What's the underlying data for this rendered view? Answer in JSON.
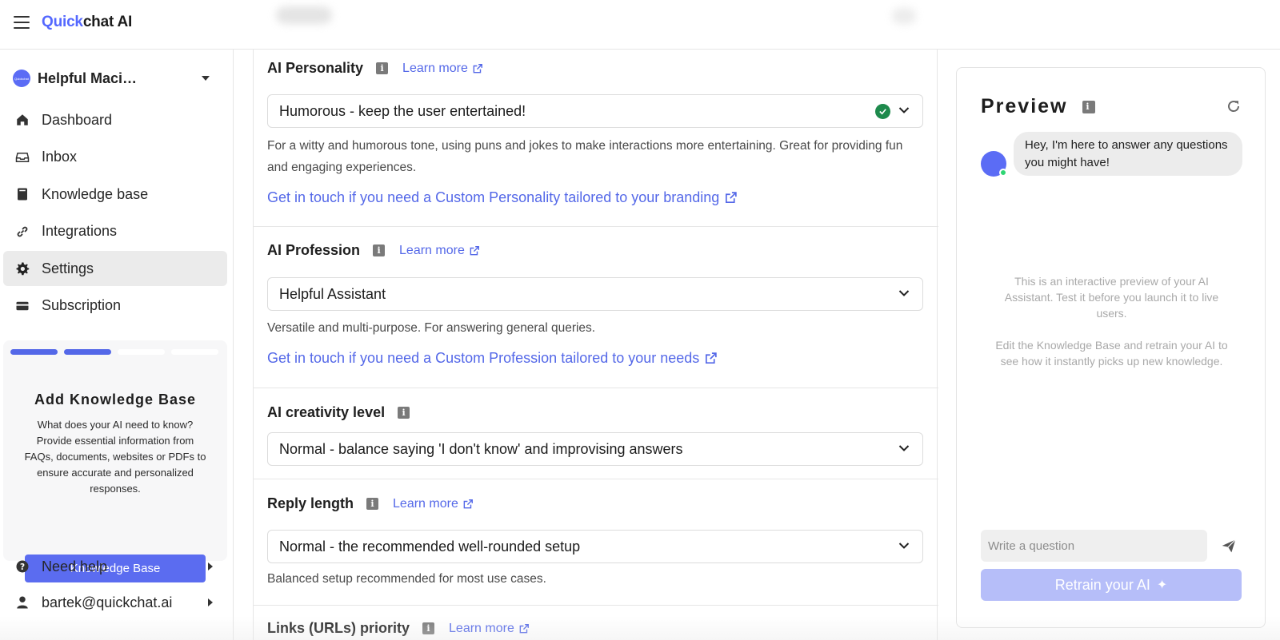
{
  "app": {
    "brand_first": "Quick",
    "brand_second": "chat AI"
  },
  "sidebar": {
    "bot_name": "Helpful Maci…",
    "bot_avatar_text": "Quickchat",
    "items": [
      {
        "label": "Dashboard",
        "icon": "home-icon"
      },
      {
        "label": "Inbox",
        "icon": "inbox-icon"
      },
      {
        "label": "Knowledge base",
        "icon": "book-icon"
      },
      {
        "label": "Integrations",
        "icon": "link-icon"
      },
      {
        "label": "Settings",
        "icon": "gear-icon",
        "active": true
      },
      {
        "label": "Subscription",
        "icon": "credit-card-icon"
      }
    ],
    "kb_card": {
      "progress_steps_done": 2,
      "progress_steps_total": 4,
      "title": "Add Knowledge Base",
      "text": "What does your AI need to know? Provide essential information from FAQs, documents, websites or PDFs to ensure accurate and personalized responses.",
      "button": "Knowledge Base"
    },
    "help": "Need help",
    "user": "bartek@quickchat.ai"
  },
  "main": {
    "personality": {
      "title": "AI Personality",
      "learn": "Learn more",
      "value": "Humorous - keep the user entertained!",
      "desc": "For a witty and humorous tone, using puns and jokes to make interactions more entertaining. Great for providing fun and engaging experiences.",
      "touch": "Get in touch if you need a Custom Personality tailored to your branding"
    },
    "profession": {
      "title": "AI Profession",
      "learn": "Learn more",
      "value": "Helpful Assistant",
      "desc": "Versatile and multi-purpose. For answering general queries.",
      "touch": "Get in touch if you need a Custom Profession tailored to your needs"
    },
    "creativity": {
      "title": "AI creativity level",
      "value": "Normal - balance saying 'I don't know' and improvising answers"
    },
    "reply_length": {
      "title": "Reply length",
      "learn": "Learn more",
      "value": "Normal - the recommended well-rounded setup",
      "desc": "Balanced setup recommended for most use cases."
    },
    "links_priority": {
      "title": "Links (URLs) priority",
      "learn": "Learn more"
    }
  },
  "preview": {
    "title": "Preview",
    "bubble": "Hey, I'm here to answer any questions you might have!",
    "note1": "This is an interactive preview of your AI Assistant. Test it before you launch it to live users.",
    "note2": "Edit the Knowledge Base and retrain your AI to see how it instantly picks up new knowledge.",
    "input_placeholder": "Write a question",
    "retrain": "Retrain your AI"
  },
  "colors": {
    "accent": "#5468e8",
    "success": "#1e8a4c",
    "retrain_disabled": "#b6bef9"
  }
}
